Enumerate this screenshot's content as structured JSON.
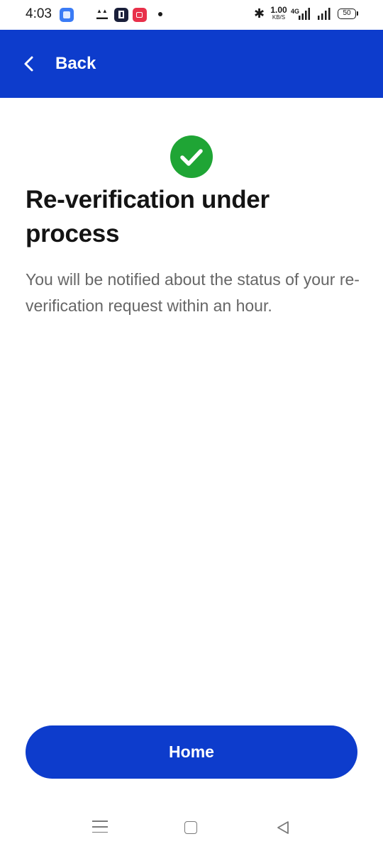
{
  "status_bar": {
    "time": "4:03",
    "network_speed_value": "1.00",
    "network_speed_unit": "KB/S",
    "network_type": "4G",
    "battery_level": "50",
    "icons": [
      "app-notification-icon",
      "news-app-icon",
      "app-icon",
      "recorder-icon",
      "dot-indicator",
      "bluetooth-icon",
      "signal-icon",
      "battery-icon"
    ]
  },
  "header": {
    "back_label": "Back",
    "background_color": "#0d3ccc"
  },
  "main": {
    "status_icon": "check-circle-icon",
    "status_color": "#1fa535",
    "title": "Re-verification under process",
    "message": "You will be notified about the status of your re-verification request within an hour."
  },
  "footer": {
    "home_label": "Home"
  },
  "nav_bar": {
    "icons": [
      "menu-icon",
      "home-icon",
      "back-icon"
    ]
  }
}
